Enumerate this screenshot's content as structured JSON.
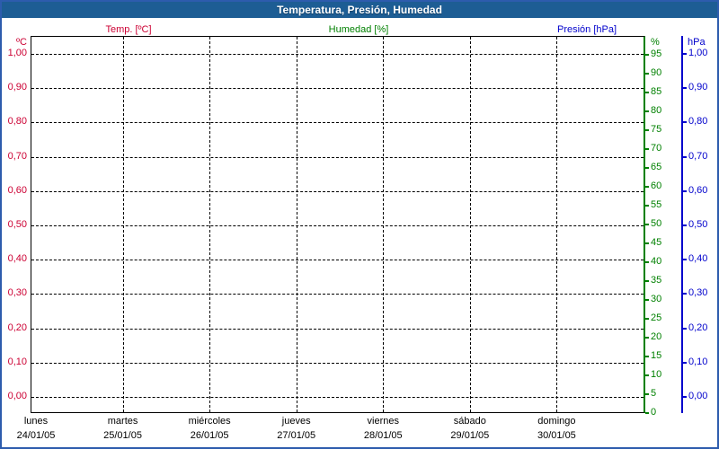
{
  "header": {
    "title": "Temperatura, Presión, Humedad"
  },
  "legend": {
    "temp": "Temp. [ºC]",
    "humidity": "Humedad [%]",
    "pressure": "Presión [hPa]"
  },
  "colors": {
    "frame": "#2d5cad",
    "header_bg": "#1d5d94",
    "header_text": "#ffffff",
    "temp": "#cc0033",
    "humidity": "#008000",
    "pressure": "#0000cc",
    "grid": "#000000",
    "text": "#000000",
    "plot_bg": "#ffffff"
  },
  "chart_data": {
    "type": "line",
    "title": "Temperatura, Presión, Humedad",
    "grid": true,
    "plot_empty": true,
    "series": [
      {
        "name": "Temp. [ºC]",
        "unit": "ºC",
        "color": "#cc0033",
        "axis": "left",
        "values": []
      },
      {
        "name": "Humedad [%]",
        "unit": "%",
        "color": "#008000",
        "axis": "right_inner",
        "values": []
      },
      {
        "name": "Presión [hPa]",
        "unit": "hPa",
        "color": "#0000cc",
        "axis": "right_outer",
        "values": []
      }
    ],
    "x_axis": {
      "days": [
        {
          "weekday": "lunes",
          "date": "24/01/05"
        },
        {
          "weekday": "martes",
          "date": "25/01/05"
        },
        {
          "weekday": "miércoles",
          "date": "26/01/05"
        },
        {
          "weekday": "jueves",
          "date": "27/01/05"
        },
        {
          "weekday": "viernes",
          "date": "28/01/05"
        },
        {
          "weekday": "sábado",
          "date": "29/01/05"
        },
        {
          "weekday": "domingo",
          "date": "30/01/05"
        }
      ]
    },
    "axes": {
      "temperature": {
        "unit": "ºC",
        "side": "left",
        "min": 0.0,
        "max": 1.0,
        "step": 0.1,
        "tick_labels": [
          "1,00",
          "0,90",
          "0,80",
          "0,70",
          "0,60",
          "0,50",
          "0,40",
          "0,30",
          "0,20",
          "0,10",
          "0,00"
        ],
        "tick_values": [
          1.0,
          0.9,
          0.8,
          0.7,
          0.6,
          0.5,
          0.4,
          0.3,
          0.2,
          0.1,
          0.0
        ]
      },
      "humidity": {
        "unit": "%",
        "side": "right_inner",
        "min": 0,
        "max": 100,
        "step": 5,
        "tick_labels": [
          "95",
          "90",
          "85",
          "80",
          "75",
          "70",
          "65",
          "60",
          "55",
          "50",
          "45",
          "40",
          "35",
          "30",
          "25",
          "20",
          "15",
          "10",
          "5",
          "0"
        ],
        "tick_values": [
          95,
          90,
          85,
          80,
          75,
          70,
          65,
          60,
          55,
          50,
          45,
          40,
          35,
          30,
          25,
          20,
          15,
          10,
          5,
          0
        ]
      },
      "pressure": {
        "unit": "hPa",
        "side": "right_outer",
        "min": 0.0,
        "max": 1.0,
        "step": 0.1,
        "tick_labels": [
          "1,00",
          "0,90",
          "0,80",
          "0,70",
          "0,60",
          "0,50",
          "0,40",
          "0,30",
          "0,20",
          "0,10",
          "0,00"
        ],
        "tick_values": [
          1.0,
          0.9,
          0.8,
          0.7,
          0.6,
          0.5,
          0.4,
          0.3,
          0.2,
          0.1,
          0.0
        ]
      }
    }
  }
}
